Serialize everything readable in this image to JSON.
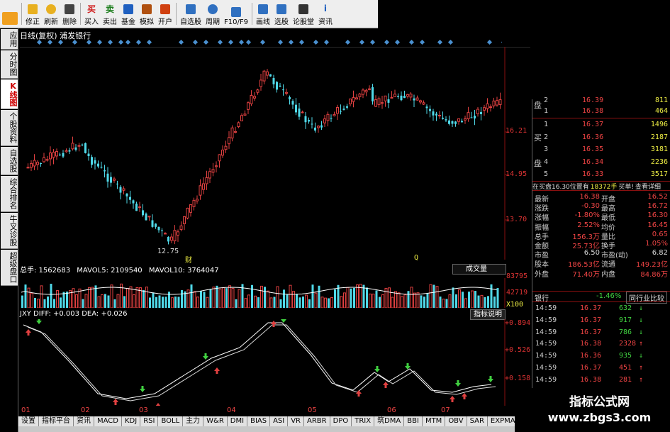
{
  "toolbar": {
    "items": [
      {
        "label": "",
        "icon": "back-arrow-icon"
      },
      {
        "label": "修正",
        "icon": "up-arrow-icon"
      },
      {
        "label": "刷新",
        "icon": "refresh-icon"
      },
      {
        "label": "删除",
        "icon": "delete-icon"
      },
      {
        "label": "买入",
        "icon": "buy-icon",
        "glyph": "买"
      },
      {
        "label": "卖出",
        "icon": "sell-icon",
        "glyph": "卖"
      },
      {
        "label": "基金",
        "icon": "fund-icon"
      },
      {
        "label": "模拟",
        "icon": "gavel-icon"
      },
      {
        "label": "开户",
        "icon": "person-icon"
      },
      {
        "label": "自选股",
        "icon": "add-stock-icon"
      },
      {
        "label": "周期",
        "icon": "clock-icon"
      },
      {
        "label": "F10/F9",
        "icon": "f10-icon"
      },
      {
        "label": "画线",
        "icon": "pen-icon"
      },
      {
        "label": "选股",
        "icon": "screen-icon"
      },
      {
        "label": "论股堂",
        "icon": "forum-icon"
      },
      {
        "label": "资讯",
        "icon": "news-icon",
        "glyph": "i"
      }
    ]
  },
  "left_tabs": [
    {
      "label": "应用",
      "active": false
    },
    {
      "label": "分时图",
      "active": false
    },
    {
      "label": "K线图",
      "active": true
    },
    {
      "label": "个股资料",
      "active": false
    },
    {
      "label": "自选股",
      "active": false
    },
    {
      "label": "综合排名",
      "active": false
    },
    {
      "label": "牛叉诊股",
      "active": false
    },
    {
      "label": "超级盘口",
      "active": false
    }
  ],
  "chart": {
    "title": "日线(复权)  浦发银行",
    "price_labels": [
      "16.21",
      "14.95",
      "13.70"
    ],
    "low_label": "12.75",
    "cai_label": "财",
    "q_label": "Q"
  },
  "volume": {
    "total": "总手: 1562683",
    "ma5": "MAVOL5: 2109540",
    "ma10": "MAVOL10: 3764047",
    "type": "成交量",
    "scale": [
      "83795",
      "42719",
      "X100"
    ]
  },
  "macd": {
    "diff": "JXY DIFF: +0.003",
    "dea": "DEA: +0.026",
    "button": "指标说明",
    "scale": [
      "+0.894",
      "+0.526",
      "+0.158"
    ]
  },
  "dates": [
    "01",
    "02",
    "03",
    "04",
    "05",
    "06",
    "07"
  ],
  "bottom_tabs": [
    "设置",
    "指标平台",
    "资讯",
    "MACD",
    "KDJ",
    "RSI",
    "BOLL",
    "主力",
    "W&R",
    "DMI",
    "BIAS",
    "ASI",
    "VR",
    "ARBR",
    "DPO",
    "TRIX",
    "筑DMA",
    "BBI",
    "MTM",
    "OBV",
    "SAR",
    "EXPMA"
  ],
  "order_book": {
    "side_sell": "盘",
    "side_buy_1": "买",
    "side_buy_2": "盘",
    "rows": [
      {
        "level": "2",
        "price": "16.39",
        "qty": "811"
      },
      {
        "level": "1",
        "price": "16.38",
        "qty": "464"
      },
      {
        "level": "1",
        "price": "16.37",
        "qty": "1496"
      },
      {
        "level": "2",
        "price": "16.36",
        "qty": "2187"
      },
      {
        "level": "3",
        "price": "16.35",
        "qty": "3181"
      },
      {
        "level": "4",
        "price": "16.34",
        "qty": "2236"
      },
      {
        "level": "5",
        "price": "16.33",
        "qty": "3517"
      }
    ]
  },
  "notice": {
    "left": "在买盘16.30位置有",
    "mid": "18372手",
    "right": "买单!",
    "link": "查看详细"
  },
  "quotes": [
    {
      "k": "最新",
      "v": "16.38",
      "k2": "开盘",
      "v2": "16.52"
    },
    {
      "k": "涨跌",
      "v": "-0.30",
      "k2": "最高",
      "v2": "16.72"
    },
    {
      "k": "涨幅",
      "v": "-1.80%",
      "k2": "最低",
      "v2": "16.30"
    },
    {
      "k": "振幅",
      "v": "2.52%",
      "k2": "均价",
      "v2": "16.45"
    },
    {
      "k": "总手",
      "v": "156.3万",
      "k2": "量比",
      "v2": "0.65"
    },
    {
      "k": "金额",
      "v": "25.73亿",
      "k2": "换手",
      "v2": "1.05%"
    },
    {
      "k": "市盈",
      "v": "6.50",
      "k2": "市盈(动)",
      "v2": "6.82"
    },
    {
      "k": "股本",
      "v": "186.53亿",
      "k2": "流通",
      "v2": "149.23亿"
    },
    {
      "k": "外盘",
      "v": "71.40万",
      "k2": "内盘",
      "v2": "84.86万"
    }
  ],
  "industry": {
    "name": "银行",
    "change": "-1.46%",
    "button": "同行业比较"
  },
  "ticks": [
    {
      "time": "14:59",
      "price": "16.37",
      "qty": "632",
      "dir": "down"
    },
    {
      "time": "14:59",
      "price": "16.37",
      "qty": "917",
      "dir": "down"
    },
    {
      "time": "14:59",
      "price": "16.37",
      "qty": "786",
      "dir": "down"
    },
    {
      "time": "14:59",
      "price": "16.38",
      "qty": "2328",
      "dir": "up"
    },
    {
      "time": "14:59",
      "price": "16.36",
      "qty": "935",
      "dir": "down"
    },
    {
      "time": "14:59",
      "price": "16.37",
      "qty": "451",
      "dir": "up"
    },
    {
      "time": "14:59",
      "price": "16.38",
      "qty": "281",
      "dir": "up"
    },
    {
      "time": "14:59",
      "price": "16.38",
      "qty": "",
      "dir": ""
    }
  ],
  "watermark": {
    "line1": "指标公式网",
    "line2": "www.zbgs3.com"
  },
  "colors": {
    "up": "#e04040",
    "down": "#4fd8e8",
    "bg": "#000000",
    "text_red": "#e44444",
    "text_yellow": "#eeee44"
  }
}
